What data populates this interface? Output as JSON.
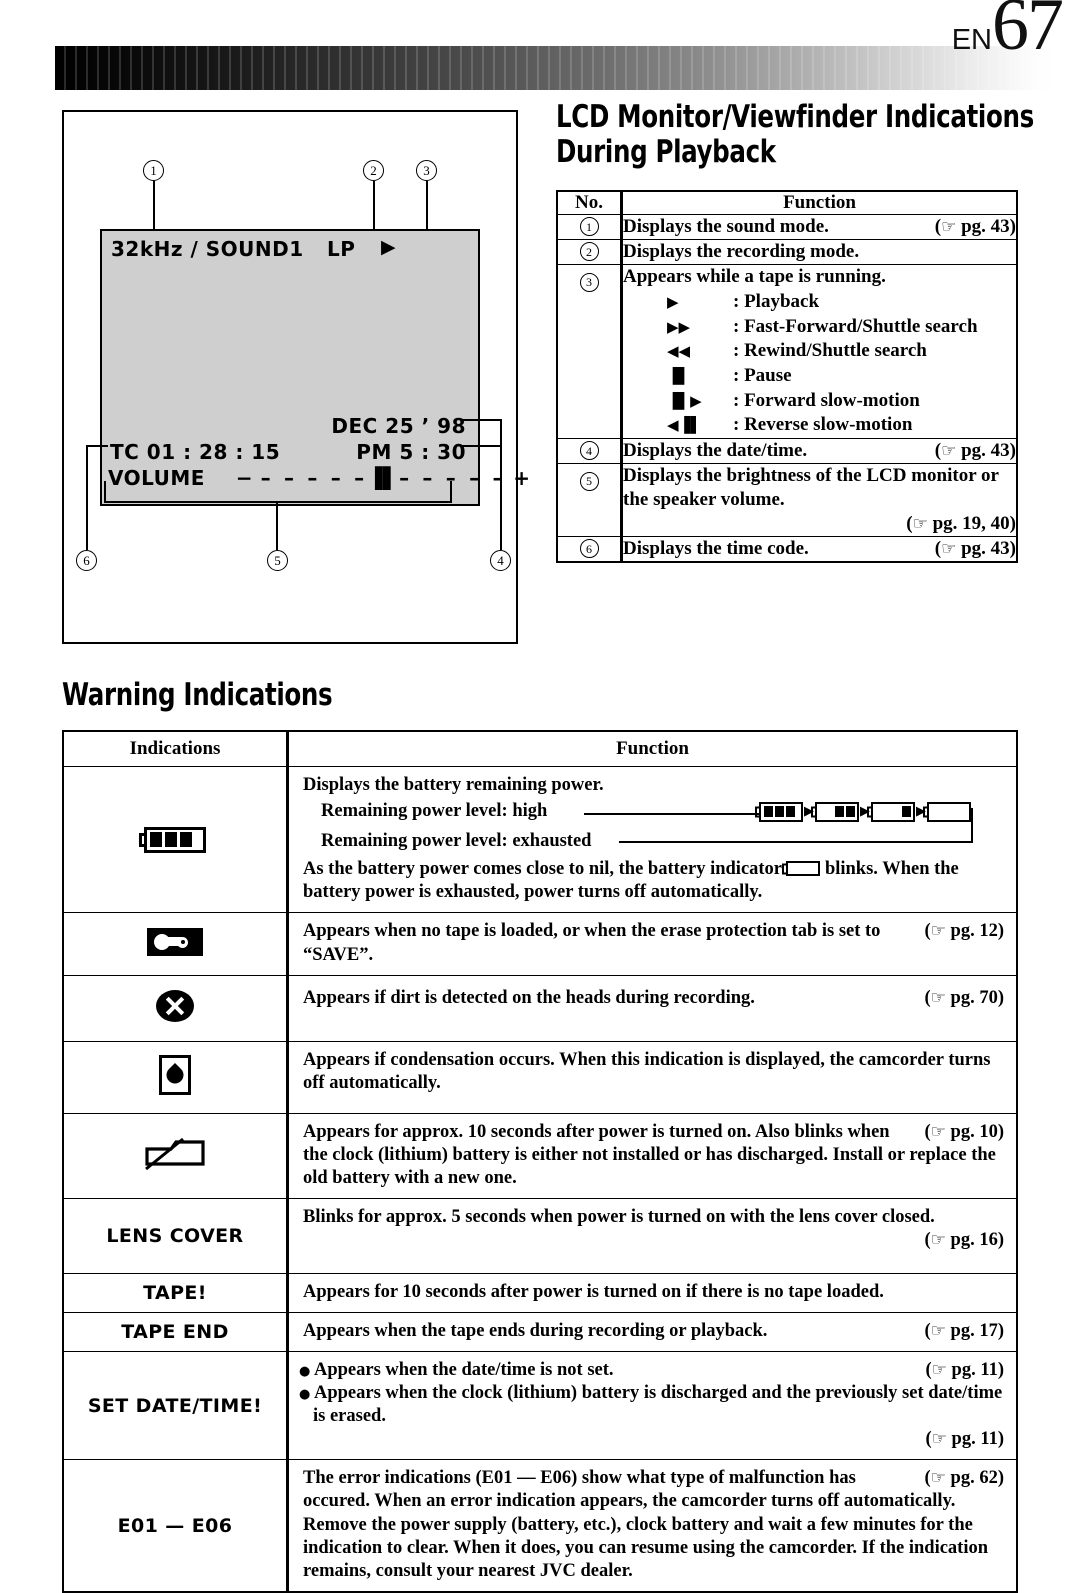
{
  "header": {
    "lang_code": "EN",
    "page_number": "67"
  },
  "main_title": "LCD Monitor/Viewfinder Indications During Playback",
  "lcd_illustration": {
    "osd": {
      "sound_mode": "32kHz / SOUND1",
      "recording_mode": "LP",
      "tape_status_icon": "▶",
      "date": "DEC 25 ’ 98",
      "time": "PM  5 : 30",
      "time_code": "TC 01 : 28 : 15",
      "volume_label": "VOLUME",
      "volume_minus": "−",
      "volume_scale_left": "– – – – –",
      "volume_marker": "▐▌",
      "volume_scale_right": "– – – – –",
      "volume_plus": "+"
    },
    "callouts": [
      "1",
      "2",
      "3",
      "4",
      "5",
      "6"
    ]
  },
  "function_table": {
    "headers": {
      "no": "No.",
      "function": "Function"
    },
    "rows": [
      {
        "no": "1",
        "text": "Displays the sound mode.",
        "pg": "pg. 43"
      },
      {
        "no": "2",
        "text": "Displays the recording mode.",
        "pg": ""
      },
      {
        "no": "3",
        "text": "Appears while a tape is running.",
        "pg": "",
        "modes": [
          {
            "glyph": "▶",
            "label": ": Playback"
          },
          {
            "glyph": "▶▶",
            "label": ": Fast-Forward/Shuttle search"
          },
          {
            "glyph": "◀◀",
            "label": ": Rewind/Shuttle search"
          },
          {
            "glyph": "▐▌",
            "label": ": Pause"
          },
          {
            "glyph": "▐▌▶",
            "label": ": Forward slow-motion"
          },
          {
            "glyph": "◀▐▌",
            "label": ": Reverse slow-motion"
          }
        ]
      },
      {
        "no": "4",
        "text": "Displays the date/time.",
        "pg": "pg. 43"
      },
      {
        "no": "5",
        "text": "Displays the brightness of the LCD monitor or the speaker volume.",
        "pg": "pg. 19, 40"
      },
      {
        "no": "6",
        "text": "Displays the time code.",
        "pg": "pg. 43"
      }
    ]
  },
  "warning_title": "Warning Indications",
  "warning_table": {
    "headers": {
      "indications": "Indications",
      "function": "Function"
    },
    "rows": [
      {
        "icon": "battery-icon",
        "label": "",
        "line1": "Displays the battery remaining power.",
        "line2": "Remaining power level: high",
        "line3": "Remaining power level: exhausted",
        "line4": "As the battery power comes close to nil, the battery indicator",
        "line4b": "blinks. When the battery power is exhausted, power turns off automatically.",
        "pg": ""
      },
      {
        "icon": "tape-icon",
        "label": "",
        "text": "Appears when no tape is loaded, or when the erase protection tab is set to “SAVE”.",
        "pg": "pg. 12"
      },
      {
        "icon": "dirty-head-icon",
        "label": "",
        "text": "Appears if dirt is detected on the heads during recording.",
        "pg": "pg. 70"
      },
      {
        "icon": "condensation-icon",
        "label": "",
        "text": "Appears if condensation occurs. When this indication is displayed, the camcorder turns off automatically.",
        "pg": ""
      },
      {
        "icon": "clock-battery-icon",
        "label": "",
        "text": "Appears for approx. 10 seconds after power is turned on. Also blinks when the clock (lithium) battery is either not installed or has discharged. Install or replace the old battery with a new one.",
        "pg": "pg. 10"
      },
      {
        "icon": "",
        "label": "LENS COVER",
        "text": "Blinks for approx. 5 seconds when power is turned on with the lens cover closed.",
        "pg": "pg. 16"
      },
      {
        "icon": "",
        "label": "TAPE!",
        "text": "Appears for 10 seconds after power is turned on if there is no tape loaded.",
        "pg": ""
      },
      {
        "icon": "",
        "label": "TAPE END",
        "text": "Appears when the tape ends during recording or playback.",
        "pg": "pg. 17"
      },
      {
        "icon": "",
        "label": "SET DATE/TIME!",
        "bullet1": "Appears when the date/time is not set.",
        "bullet1_pg": "pg. 11",
        "bullet2": "Appears when the clock (lithium) battery is discharged and the previously set date/time is erased.",
        "bullet2_pg": "pg. 11"
      },
      {
        "icon": "",
        "label": "E01 — E06",
        "text": "The error indications (E01 — E06) show what type of malfunction has occured. When an error indication appears, the camcorder turns off automatically. Remove the power supply (battery, etc.), clock battery and wait a few minutes for the indication to clear. When it does, you can resume using the camcorder. If the indication remains, consult your nearest JVC dealer.",
        "pg": "pg. 62"
      }
    ]
  },
  "icons": {
    "pointing_hand": "☞"
  },
  "colors": {
    "lcd_screen_bg": "#cfcfcf",
    "ink": "#000000",
    "page_bg": "#ffffff"
  }
}
